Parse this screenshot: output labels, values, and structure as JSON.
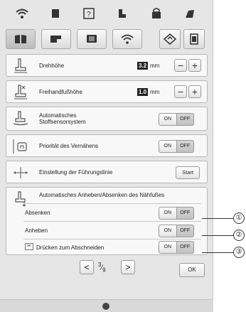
{
  "top_tabs": [
    {
      "icon": "wifi-icon"
    },
    {
      "icon": "document-icon"
    },
    {
      "icon": "help-icon"
    },
    {
      "icon": "sewing-settings-icon"
    },
    {
      "icon": "machine-icon"
    },
    {
      "icon": "sewing-needle-icon"
    }
  ],
  "icon_row": [
    {
      "icon": "book-icon",
      "active": true
    },
    {
      "icon": "sewing-machine-icon",
      "active": false
    },
    {
      "icon": "screen-icon",
      "active": false
    },
    {
      "icon": "wifi-settings-icon",
      "active": false
    }
  ],
  "icon_row_right": [
    {
      "icon": "diamond-settings-icon"
    },
    {
      "icon": "frame-settings-icon"
    }
  ],
  "pivot": {
    "label": "Drehhöhe",
    "value": "3.2",
    "unit": "mm",
    "minus": "−",
    "plus": "+"
  },
  "freemotion": {
    "label": "Freihandfußhöhe",
    "value": "1.0",
    "unit": "mm",
    "minus": "−",
    "plus": "+"
  },
  "sensor": {
    "label_line1": "Automatisches",
    "label_line2": "Stoffsensorsystem",
    "on": "ON",
    "off": "OFF"
  },
  "lock": {
    "label": "Priorität des Vernähens",
    "on": "ON",
    "off": "OFF"
  },
  "guideline": {
    "label": "Einstellung der Führungslinie",
    "button": "Start"
  },
  "lift": {
    "title": "Automatisches Anheben/Absenken des Nähfußes",
    "down": {
      "label": "Absenken",
      "on": "ON",
      "off": "OFF"
    },
    "up": {
      "label": "Anheben",
      "on": "ON",
      "off": "OFF"
    },
    "cut": {
      "label": "Drücken zum Abschneiden",
      "on": "ON",
      "off": "OFF"
    }
  },
  "footer": {
    "prev": "<",
    "page_num": "3",
    "page_sep": "⁄",
    "page_total": "9",
    "next": ">",
    "ok": "OK"
  },
  "callouts": [
    "①",
    "②",
    "③"
  ]
}
